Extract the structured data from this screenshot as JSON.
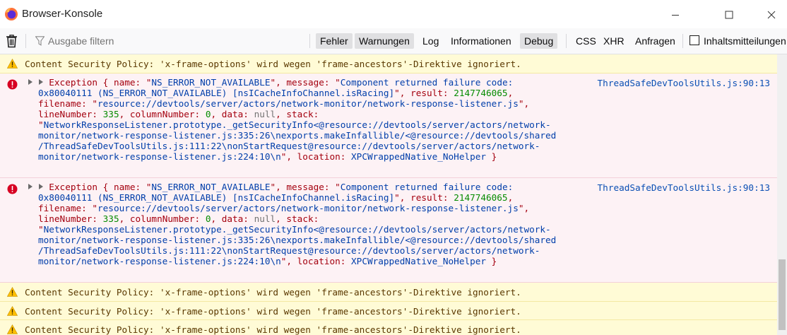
{
  "window": {
    "title": "Browser-Konsole",
    "icons": [
      "firefox-logo-icon",
      "minimize-icon",
      "maximize-icon",
      "close-icon"
    ]
  },
  "toolbar": {
    "filter_placeholder": "Ausgabe filtern",
    "filters": [
      {
        "label": "Fehler",
        "active": true
      },
      {
        "label": "Warnungen",
        "active": true
      },
      {
        "label": "Log",
        "active": false
      },
      {
        "label": "Informationen",
        "active": false
      },
      {
        "label": "Debug",
        "active": true
      }
    ],
    "requests": [
      {
        "label": "CSS"
      },
      {
        "label": "XHR"
      },
      {
        "label": "Anfragen"
      }
    ],
    "content_messages": {
      "label": "Inhaltsmitteilungen",
      "checked": false
    }
  },
  "messages": [
    {
      "level": "warning",
      "text": "Content Security Policy: 'x-frame-options' wird wegen 'frame-ancestors'-Direktive ignoriert."
    },
    {
      "level": "error",
      "location_file": "ThreadSafeDevToolsUtils.js",
      "location_pos": ":90:13",
      "name": "NS_ERROR_NOT_AVAILABLE",
      "message_a": "Component returned failure code:",
      "message_b": "0x80040111 (NS_ERROR_NOT_AVAILABLE) [nsICacheInfoChannel.isRacing]",
      "result": "2147746065",
      "filename": "resource://devtools/server/actors/network-monitor/network-response-listener.js",
      "lineNumber": "335",
      "columnNumber": "0",
      "data": "null",
      "stack_1": "NetworkResponseListener.prototype._getSecurityInfo<@resource://devtools/server/actors/network-",
      "stack_2": "monitor/network-response-listener.js:335:26\\nexports.makeInfallible/<@resource://devtools/shared",
      "stack_3": "/ThreadSafeDevToolsUtils.js:111:22\\nonStartRequest@resource://devtools/server/actors/network-",
      "stack_4": "monitor/network-response-listener.js:224:10\\n",
      "location": "XPCWrappedNative_NoHelper"
    },
    {
      "level": "error",
      "location_file": "ThreadSafeDevToolsUtils.js",
      "location_pos": ":90:13",
      "name": "NS_ERROR_NOT_AVAILABLE",
      "message_a": "Component returned failure code:",
      "message_b": "0x80040111 (NS_ERROR_NOT_AVAILABLE) [nsICacheInfoChannel.isRacing]",
      "result": "2147746065",
      "filename": "resource://devtools/server/actors/network-monitor/network-response-listener.js",
      "lineNumber": "335",
      "columnNumber": "0",
      "data": "null",
      "stack_1": "NetworkResponseListener.prototype._getSecurityInfo<@resource://devtools/server/actors/network-",
      "stack_2": "monitor/network-response-listener.js:335:26\\nexports.makeInfallible/<@resource://devtools/shared",
      "stack_3": "/ThreadSafeDevToolsUtils.js:111:22\\nonStartRequest@resource://devtools/server/actors/network-",
      "stack_4": "monitor/network-response-listener.js:224:10\\n",
      "location": "XPCWrappedNative_NoHelper"
    },
    {
      "level": "warning",
      "text": "Content Security Policy: 'x-frame-options' wird wegen 'frame-ancestors'-Direktive ignoriert."
    },
    {
      "level": "warning",
      "text": "Content Security Policy: 'x-frame-options' wird wegen 'frame-ancestors'-Direktive ignoriert."
    },
    {
      "level": "warning",
      "text": "Content Security Policy: 'x-frame-options' wird wegen 'frame-ancestors'-Direktive ignoriert."
    }
  ],
  "colors": {
    "warning_bg": "#fffbd6",
    "error_bg": "#fdf2f5",
    "error_icon": "#d70022",
    "warning_icon": "#ffbf00",
    "link": "#0a4fb4"
  }
}
